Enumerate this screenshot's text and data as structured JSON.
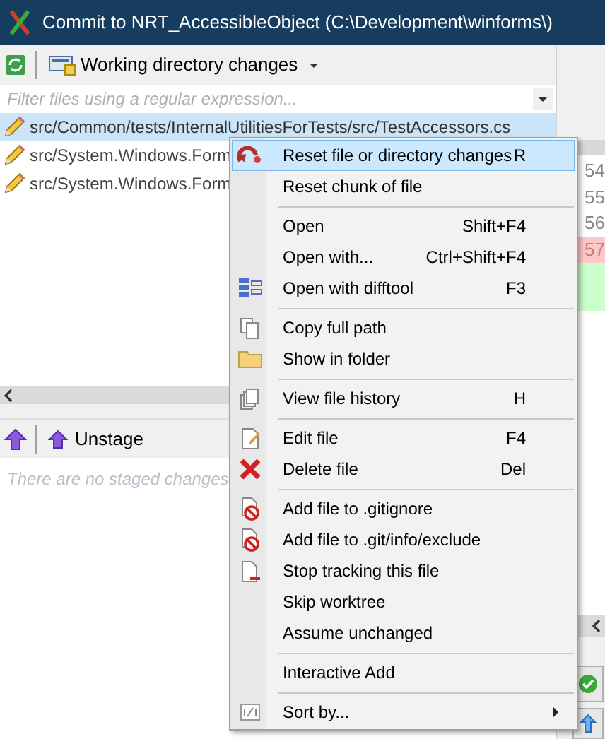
{
  "window": {
    "title": "Commit to NRT_AccessibleObject (C:\\Development\\winforms\\)"
  },
  "toolbar": {
    "view_selector": "Working directory changes"
  },
  "filter": {
    "placeholder": "Filter files using a regular expression..."
  },
  "unstaged_files": [
    {
      "path": "src/Common/tests/InternalUtilitiesForTests/src/TestAccessors.cs",
      "selected": true
    },
    {
      "path": "src/System.Windows.Form",
      "selected": false
    },
    {
      "path": "src/System.Windows.Form",
      "selected": false
    }
  ],
  "diff_gutter": [
    {
      "number": "54",
      "kind": "context"
    },
    {
      "number": "55",
      "kind": "context"
    },
    {
      "number": "56",
      "kind": "context"
    },
    {
      "number": "57",
      "kind": "removed"
    }
  ],
  "staged_toolbar": {
    "unstage_button": "Unstage"
  },
  "staged_empty_message": "There are no staged changes",
  "context_menu": [
    {
      "kind": "item",
      "label": "Reset file or directory changes",
      "shortcut": "R",
      "selected": true
    },
    {
      "kind": "item",
      "label": "Reset chunk of file",
      "selected": false
    },
    {
      "kind": "separator"
    },
    {
      "kind": "item",
      "label": "Open",
      "shortcut": "Shift+F4",
      "selected": false
    },
    {
      "kind": "item",
      "label": "Open with...",
      "shortcut": "Ctrl+Shift+F4",
      "selected": false
    },
    {
      "kind": "item",
      "label": "Open with difftool",
      "shortcut": "F3",
      "selected": false
    },
    {
      "kind": "separator"
    },
    {
      "kind": "item",
      "label": "Copy full path",
      "selected": false
    },
    {
      "kind": "item",
      "label": "Show in folder",
      "selected": false
    },
    {
      "kind": "separator"
    },
    {
      "kind": "item",
      "label": "View file history",
      "shortcut": "H",
      "selected": false
    },
    {
      "kind": "separator"
    },
    {
      "kind": "item",
      "label": "Edit file",
      "shortcut": "F4",
      "selected": false
    },
    {
      "kind": "item",
      "label": "Delete file",
      "shortcut": "Del",
      "selected": false
    },
    {
      "kind": "separator"
    },
    {
      "kind": "item",
      "label": "Add file to .gitignore",
      "selected": false
    },
    {
      "kind": "item",
      "label": "Add file to .git/info/exclude",
      "selected": false
    },
    {
      "kind": "item",
      "label": "Stop tracking this file",
      "selected": false
    },
    {
      "kind": "item",
      "label": "Skip worktree",
      "selected": false
    },
    {
      "kind": "item",
      "label": "Assume unchanged",
      "selected": false
    },
    {
      "kind": "separator"
    },
    {
      "kind": "item",
      "label": "Interactive Add",
      "selected": false
    },
    {
      "kind": "separator"
    },
    {
      "kind": "item",
      "label": "Sort by...",
      "selected": false,
      "submenu": true
    }
  ]
}
